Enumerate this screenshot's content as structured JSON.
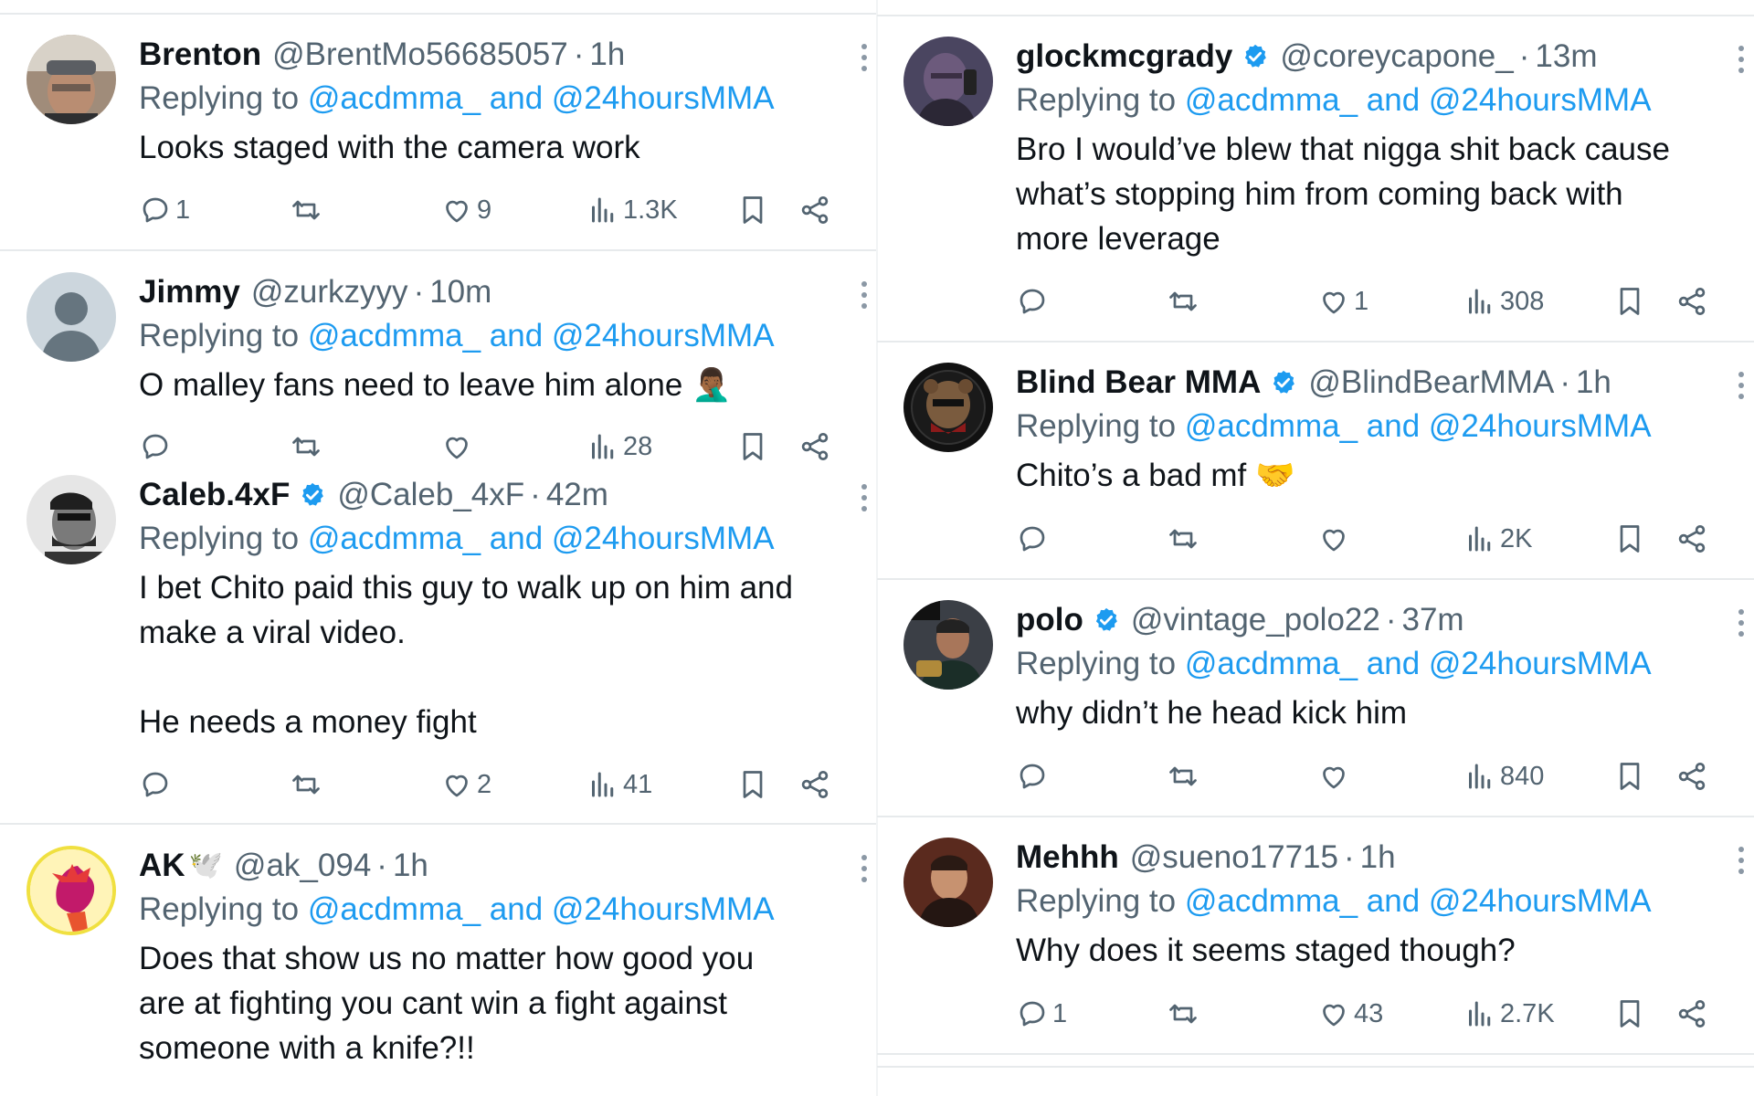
{
  "left": [
    {
      "name": "Brenton",
      "handle": "@BrentMo56685057",
      "time": "1h",
      "verified": false,
      "reply_prefix": "Replying to",
      "reply_mentions": "@acdmma_ and @24hoursMMA",
      "text": [
        "Looks staged with the camera work"
      ],
      "replies": "1",
      "retweets": "",
      "likes": "9",
      "views": "1.3K"
    },
    {
      "name": "Jimmy",
      "handle": "@zurkzyyy",
      "time": "10m",
      "verified": false,
      "reply_prefix": "Replying to",
      "reply_mentions": "@acdmma_ and @24hoursMMA",
      "text": [
        "O malley fans need to leave him alone 🤦🏾‍♂️"
      ],
      "replies": "",
      "retweets": "",
      "likes": "",
      "views": "28"
    },
    {
      "name": "Caleb.4xF",
      "handle": "@Caleb_4xF",
      "time": "42m",
      "verified": true,
      "reply_prefix": "Replying to",
      "reply_mentions": "@acdmma_ and @24hoursMMA",
      "text": [
        "I bet Chito paid this guy to walk up on him and",
        "make a viral video.",
        "",
        "He needs a money fight"
      ],
      "replies": "",
      "retweets": "",
      "likes": "2",
      "views": "41"
    },
    {
      "name": "AK",
      "name_emoji": "🕊️",
      "handle": "@ak_094",
      "time": "1h",
      "verified": false,
      "reply_prefix": "Replying to",
      "reply_mentions": "@acdmma_ and @24hoursMMA",
      "text": [
        "Does that show us no matter how good you",
        "are at fighting you cant win a fight against",
        "someone with a knife?!!"
      ]
    }
  ],
  "right": [
    {
      "name": "glockmcgrady",
      "handle": "@coreycapone_",
      "time": "13m",
      "verified": true,
      "reply_prefix": "Replying to",
      "reply_mentions": "@acdmma_ and @24hoursMMA",
      "text": [
        "Bro I would’ve blew that nigga shit back cause",
        "what’s stopping him from coming back with",
        "more leverage"
      ],
      "replies": "",
      "retweets": "",
      "likes": "1",
      "views": "308"
    },
    {
      "name": "Blind Bear MMA",
      "handle": "@BlindBearMMA",
      "time": "1h",
      "verified": true,
      "reply_prefix": "Replying to",
      "reply_mentions": "@acdmma_ and @24hoursMMA",
      "text": [
        "Chito’s a bad mf 🤝"
      ],
      "replies": "",
      "retweets": "",
      "likes": "",
      "views": "2K"
    },
    {
      "name": "polo",
      "handle": "@vintage_polo22",
      "time": "37m",
      "verified": true,
      "reply_prefix": "Replying to",
      "reply_mentions": "@acdmma_ and @24hoursMMA",
      "text": [
        "why didn’t he head kick him"
      ],
      "replies": "",
      "retweets": "",
      "likes": "",
      "views": "840"
    },
    {
      "name": "Mehhh",
      "handle": "@sueno17715",
      "time": "1h",
      "verified": false,
      "reply_prefix": "Replying to",
      "reply_mentions": "@acdmma_ and @24hoursMMA",
      "text": [
        "Why does it seems staged though?"
      ],
      "replies": "1",
      "retweets": "",
      "likes": "43",
      "views": "2.7K"
    }
  ],
  "colors": {
    "accent": "#1d9bf0",
    "muted": "#536471",
    "text": "#0f1419"
  },
  "icons": [
    "reply-icon",
    "retweet-icon",
    "like-icon",
    "views-icon",
    "bookmark-icon",
    "share-icon",
    "verified-badge-icon",
    "more-options-icon"
  ]
}
